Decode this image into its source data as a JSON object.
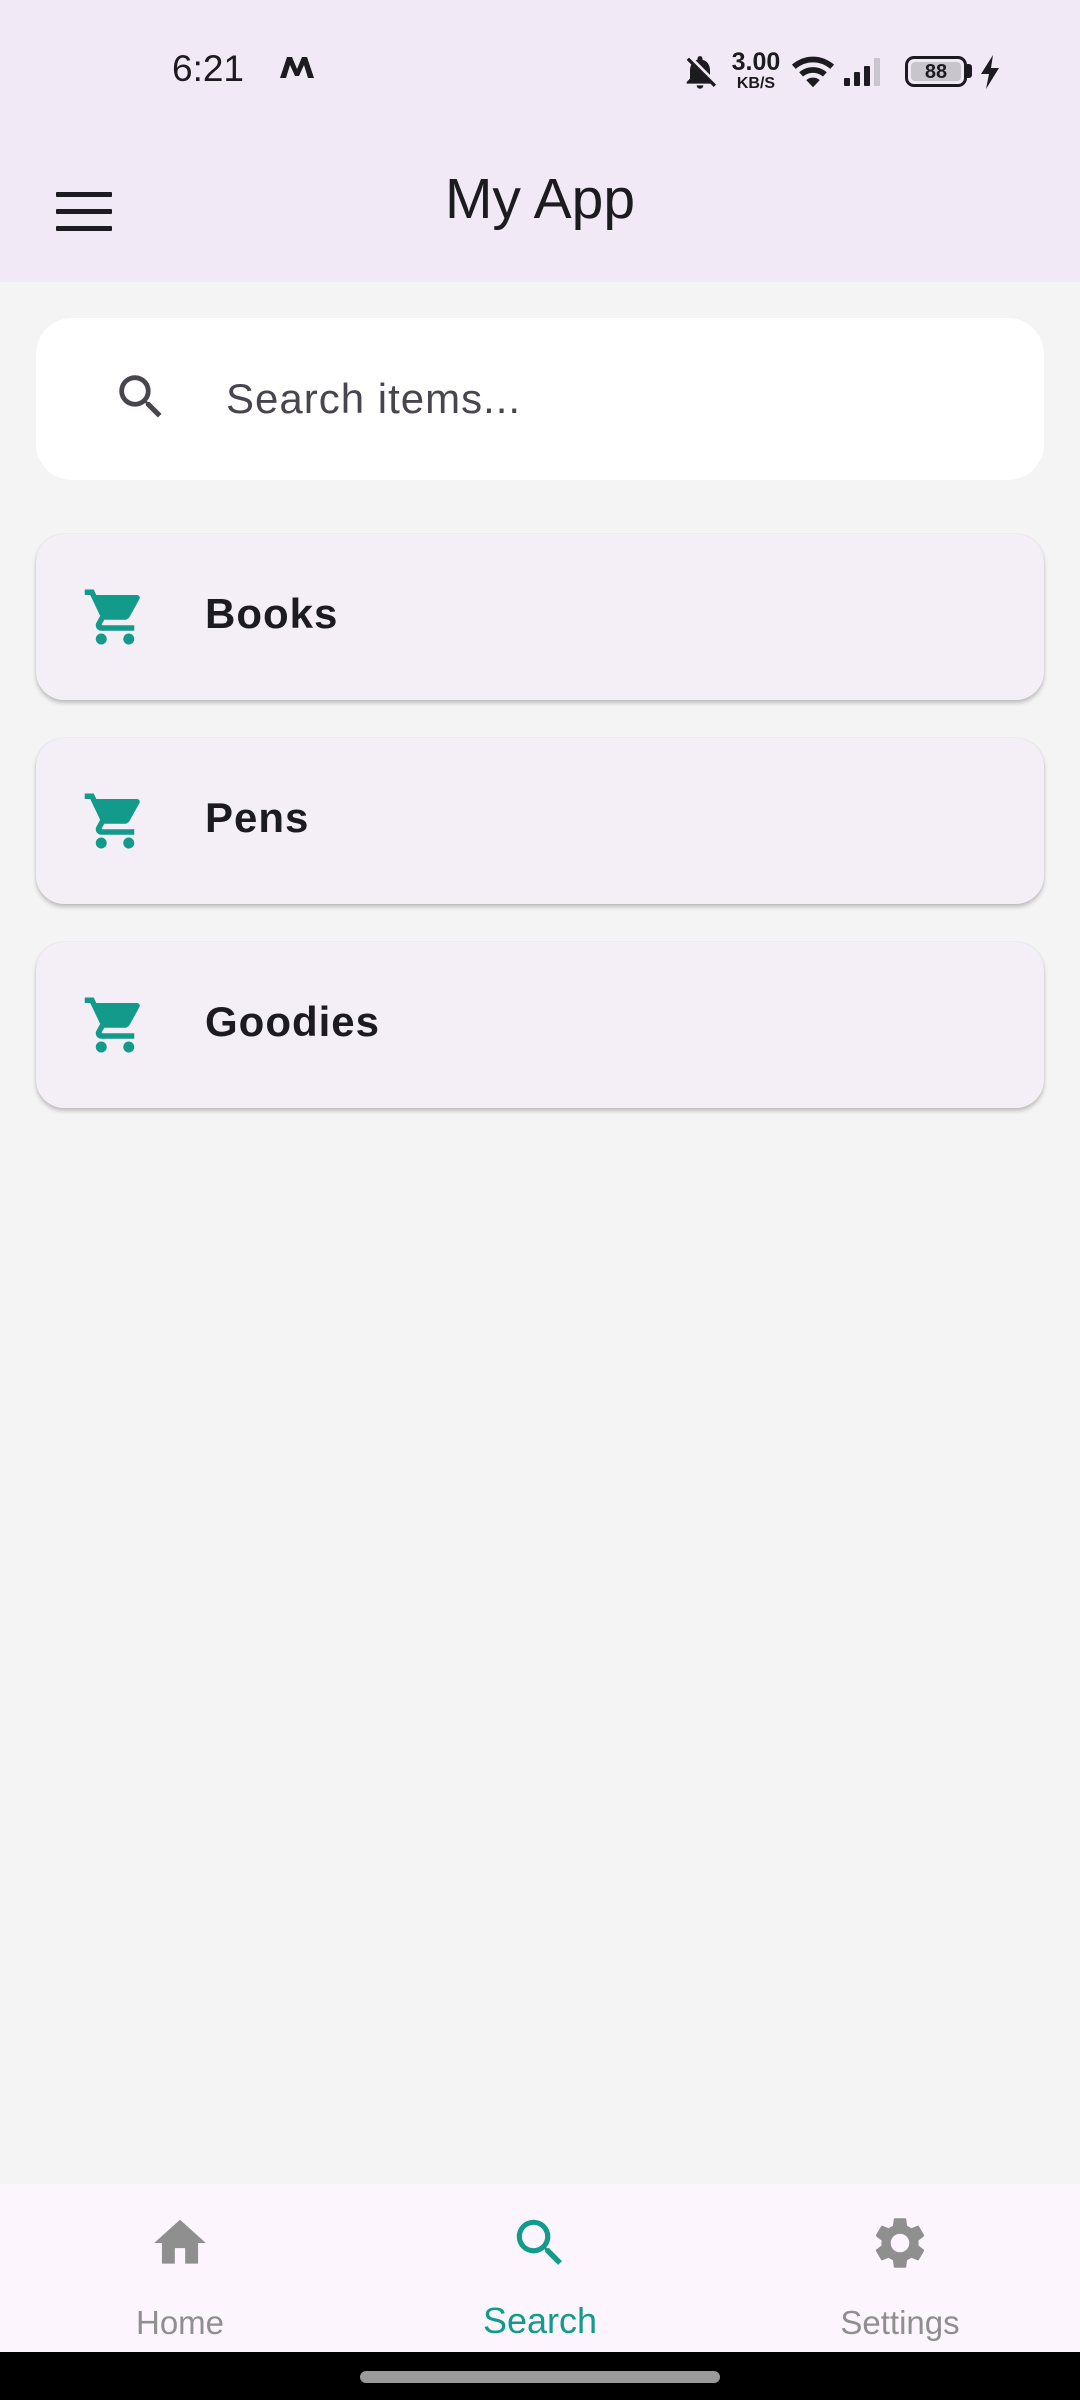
{
  "status_bar": {
    "time": "6:21",
    "net_speed_value": "3.00",
    "net_speed_unit": "KB/S",
    "battery": "88",
    "icons": [
      "m-app-icon",
      "bell-off-icon",
      "wifi-icon",
      "signal-icon",
      "battery-icon",
      "charging-bolt-icon"
    ]
  },
  "app_bar": {
    "title": "My App",
    "menu_icon": "hamburger-menu-icon"
  },
  "search": {
    "placeholder": "Search items...",
    "value": "",
    "icon": "search-icon"
  },
  "items": [
    {
      "label": "Books",
      "icon": "cart-icon"
    },
    {
      "label": "Pens",
      "icon": "cart-icon"
    },
    {
      "label": "Goodies",
      "icon": "cart-icon"
    }
  ],
  "bottom_nav": {
    "items": [
      {
        "label": "Home",
        "icon": "home-icon",
        "active": false
      },
      {
        "label": "Search",
        "icon": "search-icon",
        "active": true
      },
      {
        "label": "Settings",
        "icon": "gear-icon",
        "active": false
      }
    ]
  },
  "colors": {
    "accent": "#129a8b",
    "app_bar_bg": "#f1e9f6",
    "page_bg": "#f4f4f4",
    "card_bg": "#f4eff6",
    "inactive": "#8f8f8f"
  }
}
